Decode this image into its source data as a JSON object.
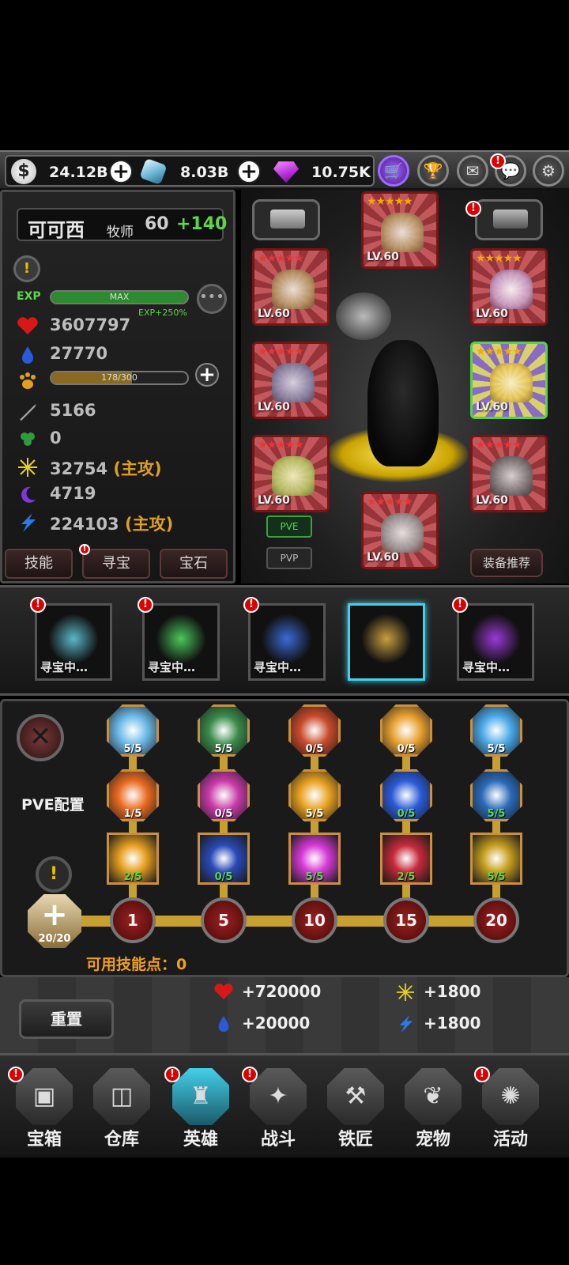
{
  "currency": {
    "coins": "24.12B",
    "crystals": "8.03B",
    "gems": "10.75K"
  },
  "hero": {
    "name": "可可西",
    "class": "牧师",
    "level": "60",
    "level_bonus": "+140"
  },
  "exp": {
    "label": "EXP",
    "bar_text": "MAX",
    "bonus": "EXP+250%",
    "fill_fraction": 1.0
  },
  "stamina": {
    "bar_text": "178/300",
    "fill_fraction": 0.593
  },
  "stats": {
    "hp": "3607797",
    "mp": "27770",
    "attack": "5166",
    "skill": "0",
    "light": "32754",
    "light_tag": "(主攻)",
    "dark": "4719",
    "lightning": "224103",
    "lightning_tag": "(主攻)"
  },
  "tabs": {
    "skills": "技能",
    "treasure": "寻宝",
    "gems": "宝石"
  },
  "equipment": {
    "slots": [
      {
        "lv": "LV.60"
      },
      {
        "lv": "LV.60"
      },
      {
        "lv": "LV.60"
      },
      {
        "lv": "LV.60"
      },
      {
        "lv": "LV.60"
      },
      {
        "lv": "LV.60"
      },
      {
        "lv": "LV.60"
      },
      {
        "lv": "LV.60"
      },
      {
        "lv": "LV.60"
      }
    ],
    "pve": "PVE",
    "pvp": "PVP",
    "recommend": "装备推荐"
  },
  "talismans": [
    {
      "label": "寻宝中…",
      "color": "#5ab8c8",
      "alert": true
    },
    {
      "label": "寻宝中…",
      "color": "#4ac85a",
      "alert": true
    },
    {
      "label": "寻宝中…",
      "color": "#3a6ad8",
      "alert": true
    },
    {
      "label": "",
      "color": "#c8a040",
      "alert": false,
      "selected": true
    },
    {
      "label": "寻宝中…",
      "color": "#9a3ad8",
      "alert": true
    }
  ],
  "skill_tree": {
    "config_label": "PVE配置",
    "levels": [
      "1",
      "5",
      "10",
      "15",
      "20"
    ],
    "root": "20/20",
    "available_label": "可用技能点：",
    "available_points": "0",
    "row1": [
      {
        "count": "5/5",
        "color": "#6ab8e8"
      },
      {
        "count": "5/5",
        "color": "#3a8a4a"
      },
      {
        "count": "0/5",
        "color": "#c84a2a"
      },
      {
        "count": "0/5",
        "color": "#e8a030"
      },
      {
        "count": "5/5",
        "color": "#4aa8e8"
      }
    ],
    "row2": [
      {
        "count": "1/5",
        "color": "#e86a20"
      },
      {
        "count": "0/5",
        "color": "#c83aa8"
      },
      {
        "count": "5/5",
        "color": "#e8a020"
      },
      {
        "count": "0/5",
        "color": "#2a5ad8"
      },
      {
        "count": "5/5",
        "color": "#2a6ab8"
      }
    ],
    "row3": [
      {
        "count": "2/5",
        "color": "#e8a020"
      },
      {
        "count": "0/5",
        "color": "#2a4ab8"
      },
      {
        "count": "5/5",
        "color": "#d83ad8"
      },
      {
        "count": "2/5",
        "color": "#c82a3a"
      },
      {
        "count": "5/5",
        "color": "#c8a020"
      }
    ]
  },
  "bonuses": {
    "reset": "重置",
    "hp": "+720000",
    "mp": "+20000",
    "light": "+1800",
    "lightning": "+1800"
  },
  "nav": [
    {
      "label": "宝箱",
      "icon": "chest-icon",
      "glyph": "▣",
      "alert": true
    },
    {
      "label": "仓库",
      "icon": "backpack-icon",
      "glyph": "◫",
      "alert": false
    },
    {
      "label": "英雄",
      "icon": "hero-icon",
      "glyph": "♜",
      "alert": true,
      "active": true
    },
    {
      "label": "战斗",
      "icon": "battle-icon",
      "glyph": "✦",
      "alert": true
    },
    {
      "label": "铁匠",
      "icon": "anvil-icon",
      "glyph": "⚒",
      "alert": false
    },
    {
      "label": "宠物",
      "icon": "pet-icon",
      "glyph": "❦",
      "alert": false
    },
    {
      "label": "活动",
      "icon": "event-icon",
      "glyph": "✺",
      "alert": true
    }
  ]
}
